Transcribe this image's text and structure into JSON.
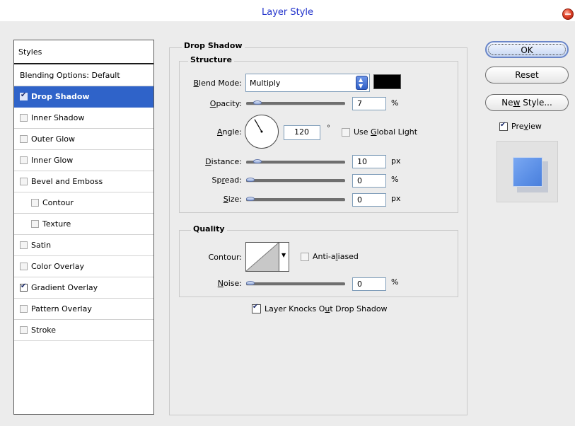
{
  "window": {
    "title": "Layer Style"
  },
  "styles_panel": {
    "header": "Styles",
    "blending_options": "Blending Options: Default",
    "items": [
      {
        "label": "Drop Shadow",
        "checked": true,
        "selected": true,
        "indent": false
      },
      {
        "label": "Inner Shadow",
        "checked": false,
        "selected": false,
        "indent": false
      },
      {
        "label": "Outer Glow",
        "checked": false,
        "selected": false,
        "indent": false
      },
      {
        "label": "Inner Glow",
        "checked": false,
        "selected": false,
        "indent": false
      },
      {
        "label": "Bevel and Emboss",
        "checked": false,
        "selected": false,
        "indent": false
      },
      {
        "label": "Contour",
        "checked": false,
        "selected": false,
        "indent": true
      },
      {
        "label": "Texture",
        "checked": false,
        "selected": false,
        "indent": true
      },
      {
        "label": "Satin",
        "checked": false,
        "selected": false,
        "indent": false
      },
      {
        "label": "Color Overlay",
        "checked": false,
        "selected": false,
        "indent": false
      },
      {
        "label": "Gradient Overlay",
        "checked": true,
        "selected": false,
        "indent": false
      },
      {
        "label": "Pattern Overlay",
        "checked": false,
        "selected": false,
        "indent": false
      },
      {
        "label": "Stroke",
        "checked": false,
        "selected": false,
        "indent": false
      }
    ]
  },
  "drop_shadow": {
    "section_title": "Drop Shadow",
    "structure": {
      "title": "Structure",
      "blend_mode": {
        "label_pre": "",
        "label_ul": "B",
        "label_post": "lend Mode:",
        "value": "Multiply",
        "color": "#000000"
      },
      "opacity": {
        "label_pre": "",
        "label_ul": "O",
        "label_post": "pacity:",
        "value": "7",
        "unit": "%",
        "level": 0.07
      },
      "angle": {
        "label_pre": "",
        "label_ul": "A",
        "label_post": "ngle:",
        "value": "120",
        "unit": "°",
        "degrees": 120,
        "use_global_light": {
          "label_pre": "Use ",
          "label_ul": "G",
          "label_post": "lobal Light",
          "checked": false
        }
      },
      "distance": {
        "label_pre": "",
        "label_ul": "D",
        "label_post": "istance:",
        "value": "10",
        "unit": "px",
        "level": 0.07
      },
      "spread": {
        "label_pre": "Sp",
        "label_ul": "r",
        "label_post": "ead:",
        "value": "0",
        "unit": "%",
        "level": 0
      },
      "size": {
        "label_pre": "",
        "label_ul": "S",
        "label_post": "ize:",
        "value": "0",
        "unit": "px",
        "level": 0
      }
    },
    "quality": {
      "title": "Quality",
      "contour": {
        "label": "Contour:"
      },
      "anti_aliased": {
        "label_pre": "Anti-a",
        "label_ul": "l",
        "label_post": "iased",
        "checked": false
      },
      "noise": {
        "label_pre": "",
        "label_ul": "N",
        "label_post": "oise:",
        "value": "0",
        "unit": "%",
        "level": 0
      }
    },
    "layer_knocks_out": {
      "label_pre": "Layer Knocks O",
      "label_ul": "u",
      "label_post": "t Drop Shadow",
      "checked": true
    }
  },
  "buttons": {
    "ok": "OK",
    "reset": "Reset",
    "new_style": {
      "label_pre": "Ne",
      "label_ul": "w",
      "label_post": " Style..."
    }
  },
  "preview": {
    "label_pre": "Pre",
    "label_ul": "v",
    "label_post": "iew",
    "checked": true,
    "swatch_color": "#5b8fe6"
  }
}
